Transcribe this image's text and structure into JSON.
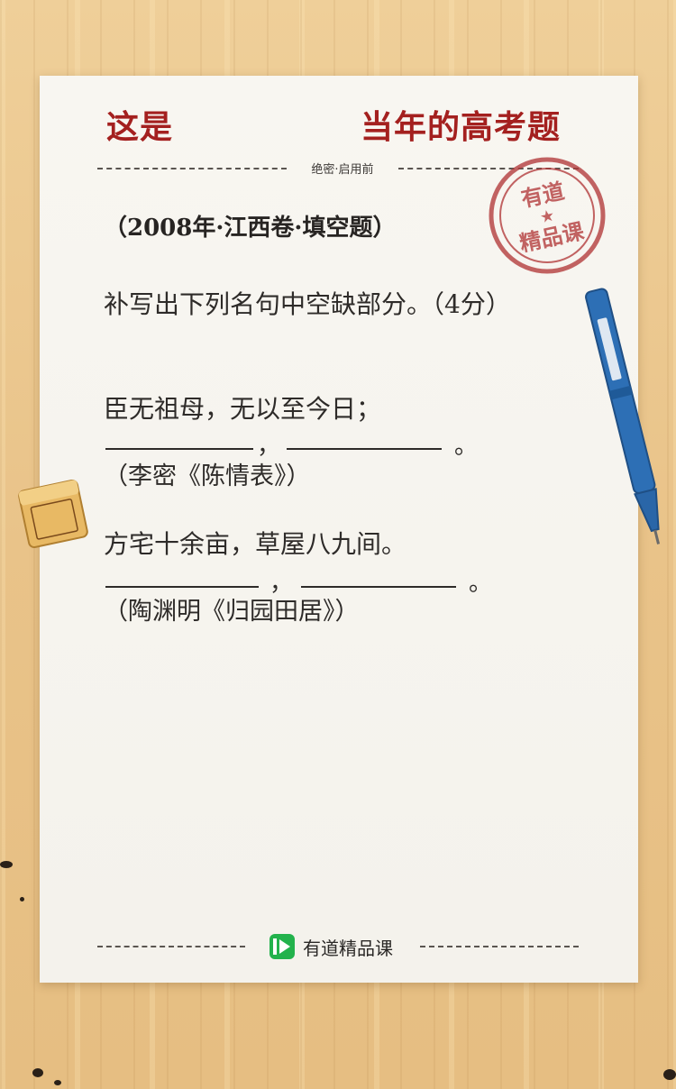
{
  "header": {
    "left": "这是",
    "right": "当年的高考题",
    "secret": "绝密·启用前"
  },
  "stamp": {
    "line1": "有道",
    "star": "★",
    "line2": "精品课"
  },
  "question": {
    "source": "（2008年·江西卷·填空题）",
    "prompt": "补写出下列名句中空缺部分。（4分）",
    "items": [
      {
        "given": "臣无祖母，无以至今日；",
        "sep": "，",
        "end": "。",
        "cite": "（李密《陈情表》）"
      },
      {
        "given": "方宅十余亩，草屋八九间。",
        "sep": "，",
        "end": "。",
        "cite": "（陶渊明《归园田居》）"
      }
    ]
  },
  "footer": {
    "brand": "有道精品课",
    "brand_color": "#22b24c"
  },
  "colors": {
    "title_red": "#a4201f",
    "stamp_red": "#b2393a",
    "pen_blue": "#2d6fb5"
  }
}
